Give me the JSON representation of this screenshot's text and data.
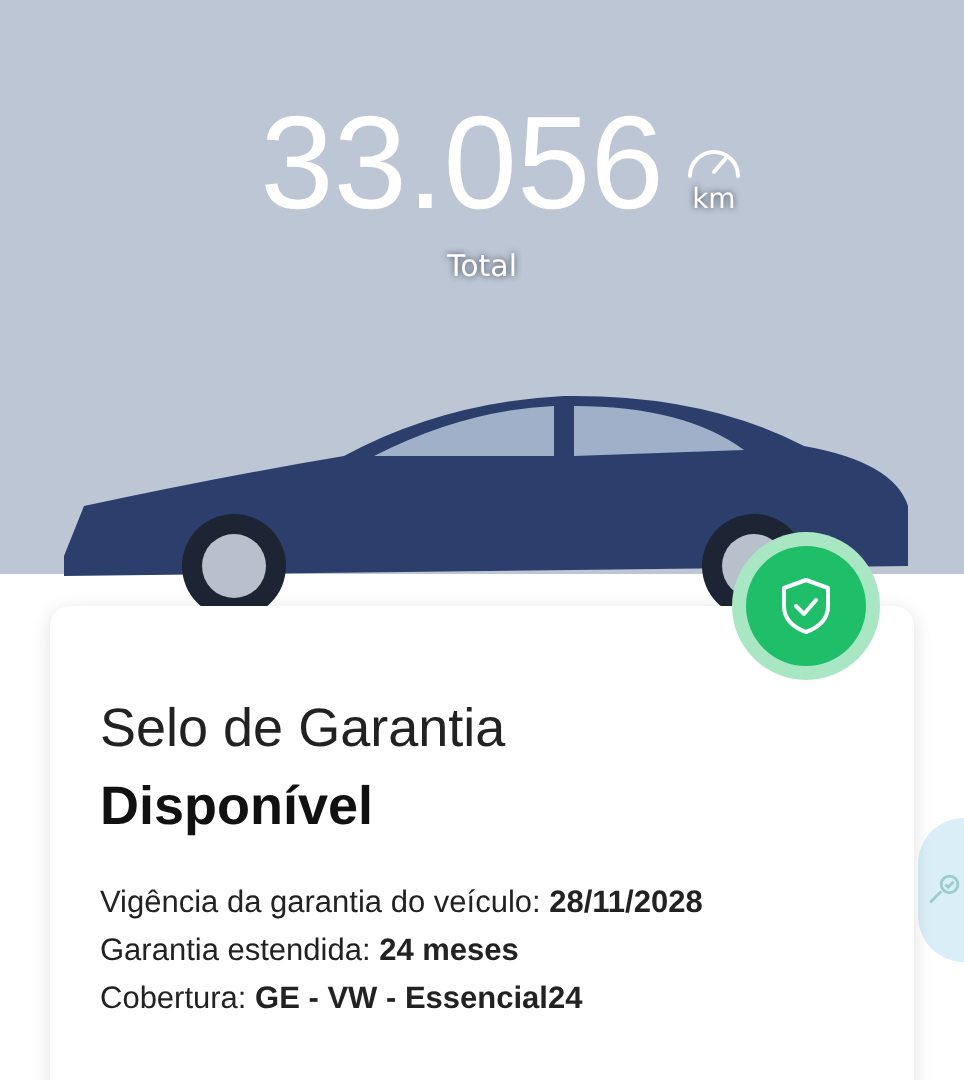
{
  "odometer": {
    "value": "33.056",
    "unit": "km",
    "label": "Total"
  },
  "warranty_card": {
    "title": "Selo de Garantia",
    "status": "Disponível",
    "status_available": true,
    "details": [
      "Vigência da garantia do veículo: **28/11/2028**",
      "Garantia estendida: **24 meses**",
      "Cobertura: **GE - VW - Essencial24**"
    ]
  }
}
